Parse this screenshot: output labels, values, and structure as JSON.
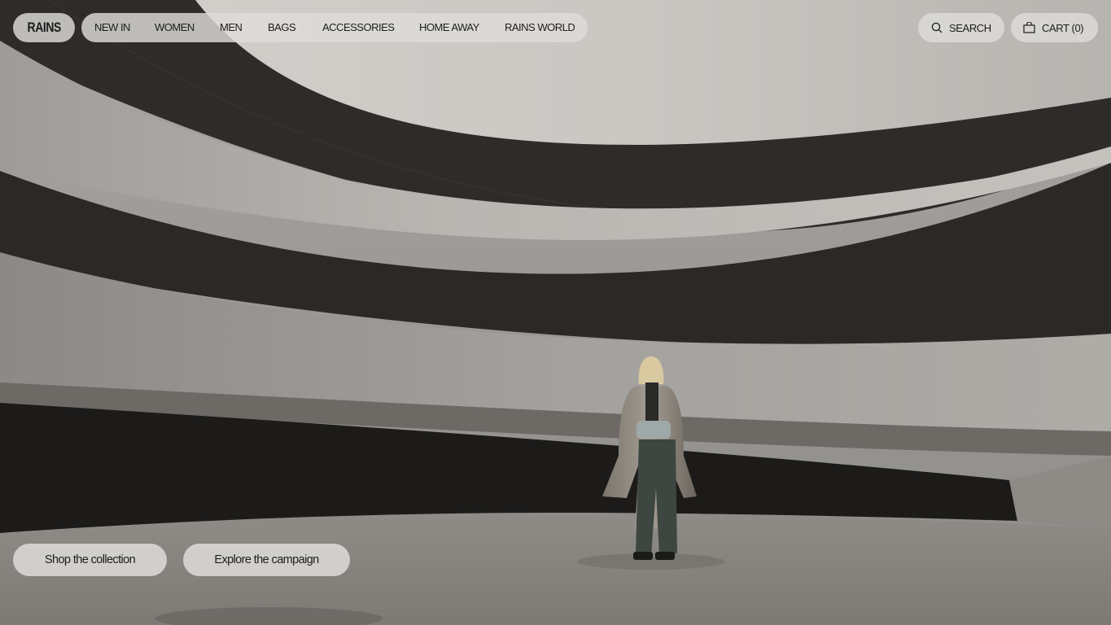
{
  "brand": {
    "logo_text": "RAINS"
  },
  "nav": {
    "items": [
      {
        "label": "NEW IN"
      },
      {
        "label": "WOMEN"
      },
      {
        "label": "MEN"
      },
      {
        "label": "BAGS"
      },
      {
        "label": "ACCESSORIES"
      },
      {
        "label": "HOME AWAY"
      },
      {
        "label": "RAINS WORLD"
      }
    ]
  },
  "header": {
    "search_label": "SEARCH",
    "search_icon": "search-icon",
    "cart_label": "CART (0)",
    "cart_icon": "shopping-bag-icon"
  },
  "hero": {
    "image": "model in metallic coat standing in circular concrete spiral structure",
    "cta_primary": "Shop the collection",
    "cta_secondary": "Explore the campaign"
  },
  "colors": {
    "pill_bg": "#dedcd9",
    "text": "#1d1d1d",
    "concrete_light": "#b9b7b3",
    "concrete_shadow": "#2a2826"
  }
}
